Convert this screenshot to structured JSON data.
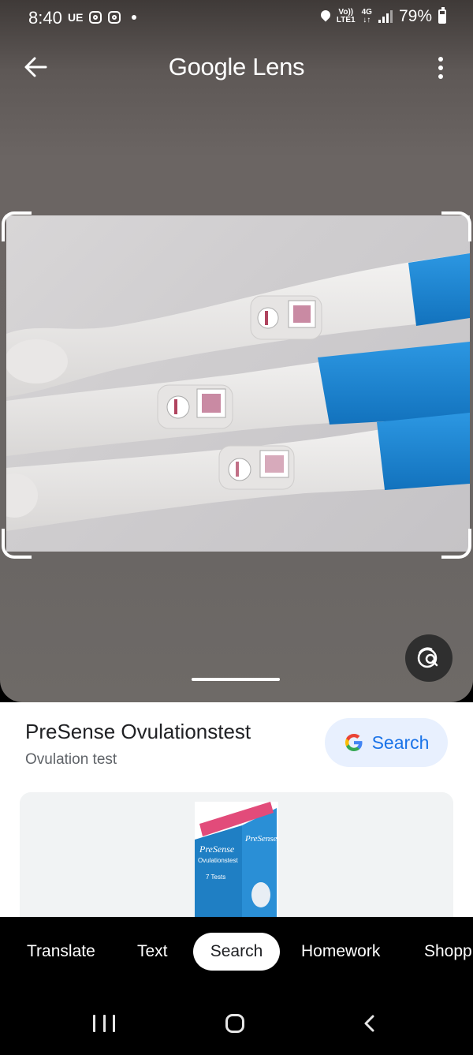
{
  "status_bar": {
    "time": "8:40",
    "carrier_tag": "UE",
    "volte": "Vo))",
    "lte": "LTE1",
    "network": "4G",
    "battery": "79%"
  },
  "header": {
    "title": "Google Lens"
  },
  "result": {
    "title": "PreSense Ovulationstest",
    "subtitle": "Ovulation test",
    "search_button": "Search"
  },
  "product_image": {
    "box_label_brand": "PreSense",
    "box_label_product": "Ovulationstest",
    "box_label_count": "7 Tests"
  },
  "modes": [
    {
      "label": "Translate",
      "active": false
    },
    {
      "label": "Text",
      "active": false
    },
    {
      "label": "Search",
      "active": true
    },
    {
      "label": "Homework",
      "active": false
    },
    {
      "label": "Shopp",
      "active": false
    }
  ],
  "colors": {
    "accent": "#1a73e8",
    "chip_bg": "#e8f0fe",
    "test_blue": "#1b86d4"
  }
}
